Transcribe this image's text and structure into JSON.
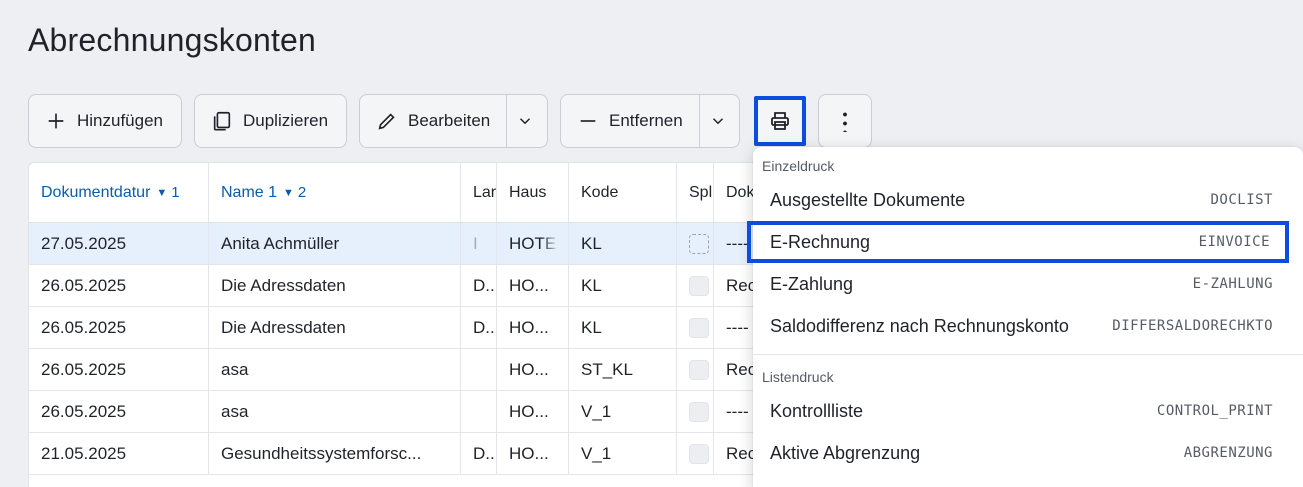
{
  "page": {
    "title": "Abrechnungskonten"
  },
  "toolbar": {
    "add_label": "Hinzufügen",
    "duplicate_label": "Duplizieren",
    "edit_label": "Bearbeiten",
    "remove_label": "Entfernen"
  },
  "table": {
    "headers": {
      "col1": "Dokumentdatur",
      "col1_sort": "1",
      "col2": "Name 1",
      "col2_sort": "2",
      "col3": "Lar",
      "col4": "Haus",
      "col5": "Kode",
      "col6": "Spl",
      "col7": "Dok"
    },
    "rows": [
      {
        "date": "27.05.2025",
        "name": "Anita Achmüller",
        "land": "I",
        "haus": "HOTE",
        "kode": "KL",
        "dok": "----"
      },
      {
        "date": "26.05.2025",
        "name": "Die Adressdaten",
        "land": "D..",
        "haus": "HO...",
        "kode": "KL",
        "dok": "Rec"
      },
      {
        "date": "26.05.2025",
        "name": "Die Adressdaten",
        "land": "D..",
        "haus": "HO...",
        "kode": "KL",
        "dok": "----"
      },
      {
        "date": "26.05.2025",
        "name": "asa",
        "land": "",
        "haus": "HO...",
        "kode": "ST_KL",
        "dok": "Rec"
      },
      {
        "date": "26.05.2025",
        "name": "asa",
        "land": "",
        "haus": "HO...",
        "kode": "V_1",
        "dok": "----"
      },
      {
        "date": "21.05.2025",
        "name": "Gesundheitssystemforsc...",
        "land": "D..",
        "haus": "HO...",
        "kode": "V_1",
        "dok": "Rec"
      }
    ]
  },
  "menu": {
    "section1": "Einzeldruck",
    "section2": "Listendruck",
    "items": [
      {
        "label": "Ausgestellte Dokumente",
        "code": "DOCLIST"
      },
      {
        "label": "E-Rechnung",
        "code": "EINVOICE"
      },
      {
        "label": "E-Zahlung",
        "code": "E-ZAHLUNG"
      },
      {
        "label": "Saldodifferenz nach Rechnungskonto",
        "code": "DIFFERSALDORECHKTO"
      },
      {
        "label": "Kontrollliste",
        "code": "CONTROL_PRINT"
      },
      {
        "label": "Aktive Abgrenzung",
        "code": "ABGRENZUNG"
      }
    ]
  },
  "colors": {
    "accent": "#0a4de0",
    "sort_link": "#0b5cad",
    "selected_row": "#e6effc"
  }
}
